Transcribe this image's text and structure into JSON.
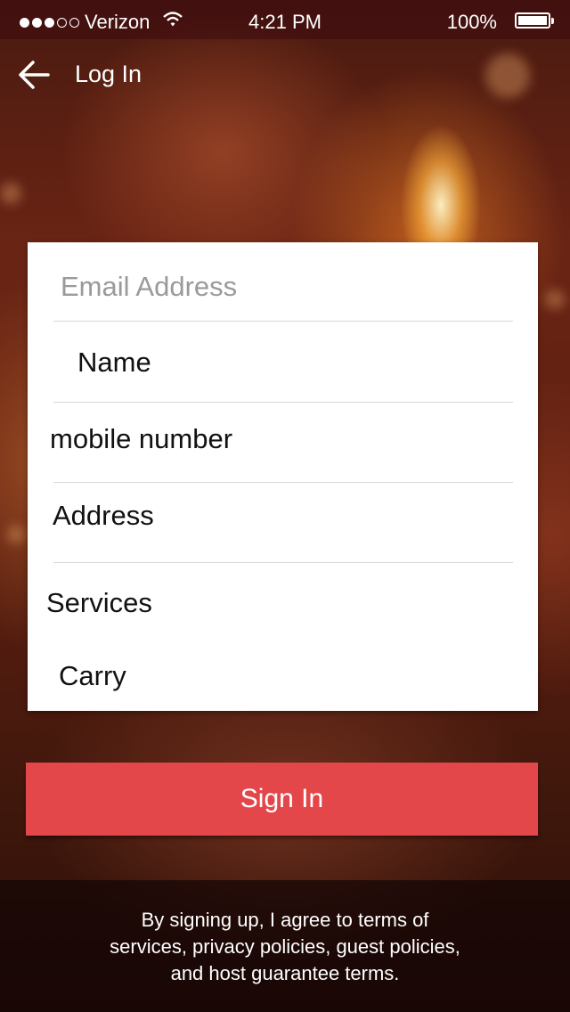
{
  "status_bar": {
    "carrier": "Verizon",
    "time": "4:21 PM",
    "battery": "100%",
    "signal_filled": 3,
    "signal_total": 5
  },
  "nav": {
    "title": "Log In",
    "back_icon": "back-arrow-icon"
  },
  "form": {
    "email_placeholder": "Email Address",
    "name": "Name",
    "mobile": "mobile number",
    "address": "Address",
    "services": "Services",
    "carry": "Carry"
  },
  "signin_label": "Sign In",
  "terms": {
    "line1": "By signing up, I agree to  terms of",
    "line2": "services, privacy policies, guest policies,",
    "line3": "and host guarantee terms."
  },
  "colors": {
    "accent": "#e3474a"
  }
}
